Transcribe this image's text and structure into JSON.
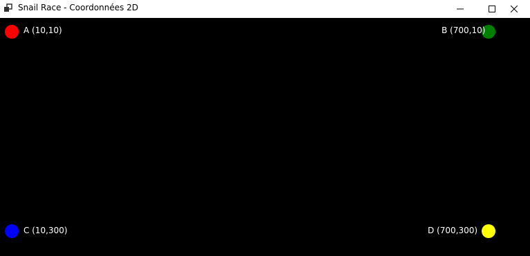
{
  "window": {
    "title": "Snail Race - Coordonnées 2D",
    "app_icon": "app-window-icon",
    "controls": {
      "minimize_icon": "minimize-icon",
      "maximize_icon": "maximize-icon",
      "close_icon": "close-icon"
    }
  },
  "canvas": {
    "background": "#000000",
    "points": [
      {
        "name": "A",
        "label": "A (10,10)",
        "color": "#ff0000"
      },
      {
        "name": "B",
        "label": "B (700,10)",
        "color": "#008000"
      },
      {
        "name": "C",
        "label": "C (10,300)",
        "color": "#0000ff"
      },
      {
        "name": "D",
        "label": "D (700,300)",
        "color": "#ffff00"
      }
    ]
  }
}
